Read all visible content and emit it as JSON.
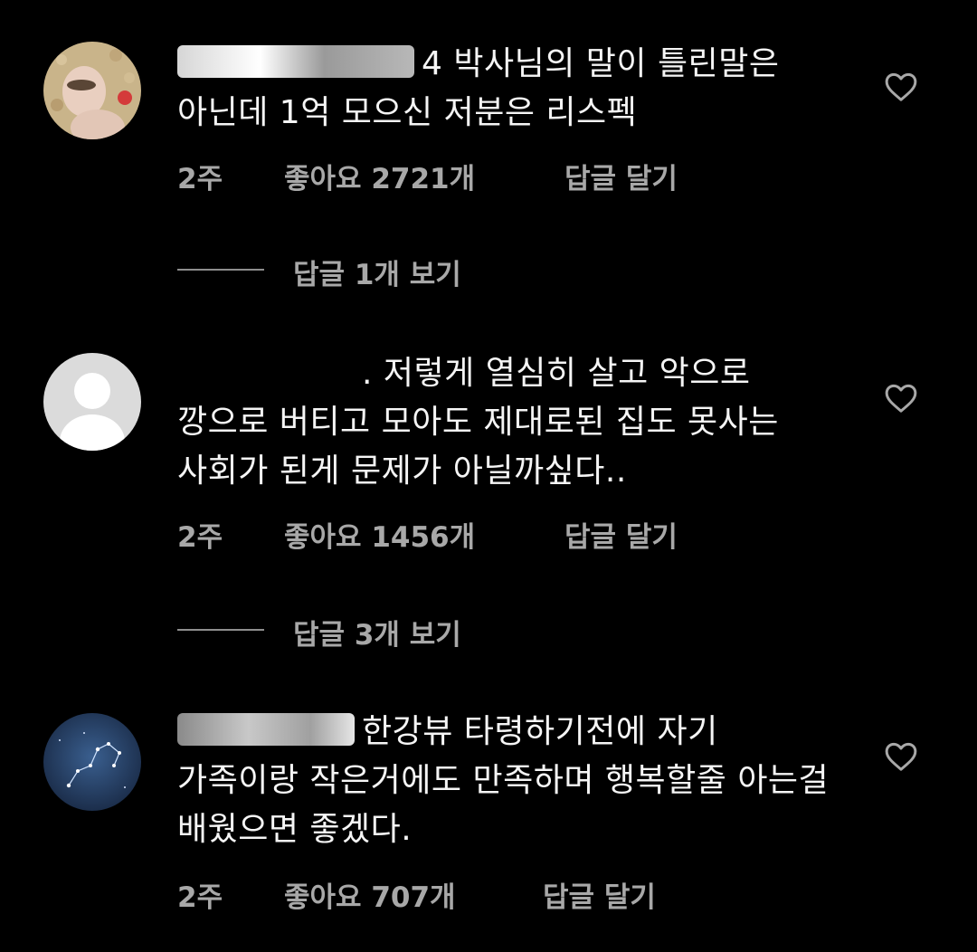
{
  "comments": [
    {
      "text": "4 박사님의 말이 틀린말은 아닌데 1억 모으신 저분은 리스펙",
      "time": "2주",
      "likes": "좋아요 2721개",
      "reply_action": "답글 달기",
      "view_replies": "답글 1개 보기",
      "heart_icon": "heart-outline-icon"
    },
    {
      "text": ". 저렇게 열심히 살고 악으로 깡으로 버티고 모아도 제대로된 집도 못사는 사회가 된게 문제가 아닐까싶다..",
      "time": "2주",
      "likes": "좋아요 1456개",
      "reply_action": "답글 달기",
      "view_replies": "답글 3개 보기",
      "heart_icon": "heart-outline-icon"
    },
    {
      "text": "한강뷰 타령하기전에 자기 가족이랑 작은거에도 만족하며 행복할줄 아는걸 배웠으면 좋겠다.",
      "time": "2주",
      "likes": "좋아요 707개",
      "reply_action": "답글 달기",
      "heart_icon": "heart-outline-icon"
    }
  ],
  "colors": {
    "background": "#000000",
    "text": "#f5f5f5",
    "meta": "#a8a8a8",
    "divider": "#8e8e8e"
  }
}
